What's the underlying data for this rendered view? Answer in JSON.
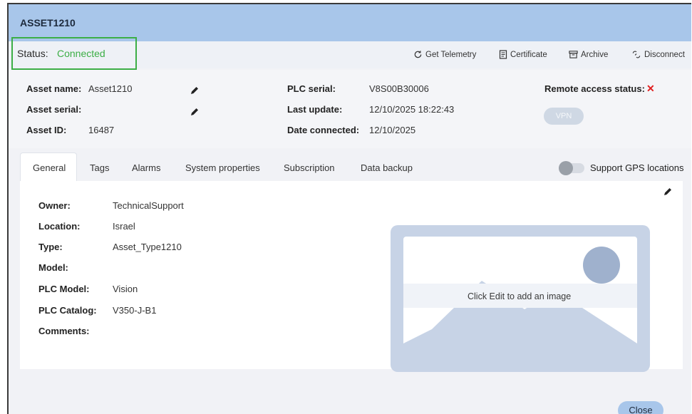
{
  "window": {
    "title": "ASSET1210"
  },
  "status": {
    "label": "Status:",
    "value": "Connected",
    "value_color": "#3cae46"
  },
  "toolbar": {
    "telemetry": "Get Telemetry",
    "certificate": "Certificate",
    "archive": "Archive",
    "disconnect": "Disconnect"
  },
  "info": {
    "asset_name_label": "Asset name:",
    "asset_name_value": "Asset1210",
    "asset_serial_label": "Asset serial:",
    "asset_serial_value": "",
    "asset_id_label": "Asset ID:",
    "asset_id_value": "16487",
    "plc_serial_label": "PLC serial:",
    "plc_serial_value": "V8S00B30006",
    "last_update_label": "Last update:",
    "last_update_value": "12/10/2025 18:22:43",
    "date_connected_label": "Date connected:",
    "date_connected_value": "12/10/2025",
    "remote_access_label": "Remote access status:",
    "remote_access_status_icon": "close-x-icon",
    "vpn_label": "VPN"
  },
  "tabs": [
    {
      "label": "General",
      "active": true
    },
    {
      "label": "Tags"
    },
    {
      "label": "Alarms"
    },
    {
      "label": "System properties"
    },
    {
      "label": "Subscription"
    },
    {
      "label": "Data backup"
    }
  ],
  "gps": {
    "label": "Support GPS locations",
    "enabled": false
  },
  "general": {
    "owner_label": "Owner:",
    "owner_value": "TechnicalSupport",
    "location_label": "Location:",
    "location_value": "Israel",
    "type_label": "Type:",
    "type_value": "Asset_Type1210",
    "model_label": "Model:",
    "model_value": "",
    "plc_model_label": "PLC Model:",
    "plc_model_value": "Vision",
    "plc_catalog_label": "PLC Catalog:",
    "plc_catalog_value": "V350-J-B1",
    "comments_label": "Comments:",
    "comments_value": ""
  },
  "image_placeholder": {
    "caption": "Click Edit to add an image"
  },
  "footer": {
    "close_label": "Close"
  },
  "colors": {
    "title_bar": "#a8c6ea",
    "accent_green": "#3cae46",
    "error_red": "#e02020"
  }
}
